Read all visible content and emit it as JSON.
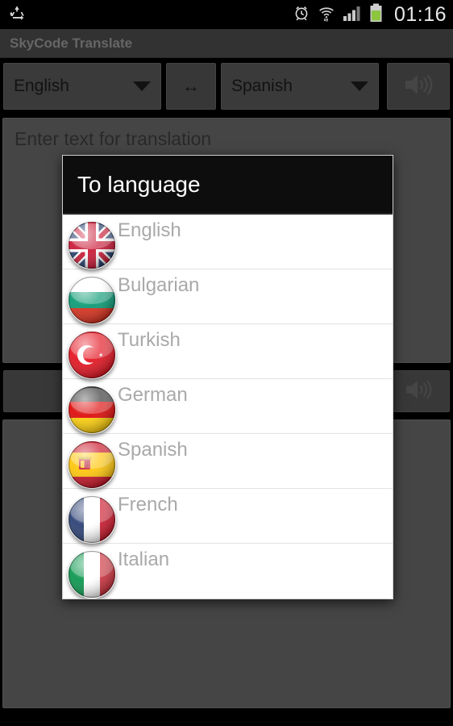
{
  "statusbar": {
    "left_icons": [
      {
        "name": "recycle-icon",
        "label": "recycle"
      }
    ],
    "right_icons": [
      {
        "name": "alarm-clock-icon",
        "label": "alarm"
      },
      {
        "name": "wifi-icon",
        "label": "wifi"
      },
      {
        "name": "signal-bars-icon",
        "label": "signal"
      },
      {
        "name": "battery-icon",
        "label": "battery"
      }
    ],
    "clock": "01:16"
  },
  "titlebar": {
    "app_title": "SkyCode Translate"
  },
  "toolbar": {
    "from_language": "English",
    "to_language": "Spanish",
    "swap_glyph": "↔",
    "swap_label": "Swap languages",
    "speak_label": "Speak"
  },
  "input": {
    "placeholder": "Enter text for translation"
  },
  "buttonbar": {
    "translate_label": "",
    "speak_label": ""
  },
  "output": {
    "text": ""
  },
  "dialog": {
    "title": "To language",
    "items": [
      {
        "label": "English",
        "flag": "flag-uk-icon"
      },
      {
        "label": "Bulgarian",
        "flag": "flag-bulgaria-icon"
      },
      {
        "label": "Turkish",
        "flag": "flag-turkey-icon"
      },
      {
        "label": "German",
        "flag": "flag-germany-icon"
      },
      {
        "label": "Spanish",
        "flag": "flag-spain-icon"
      },
      {
        "label": "French",
        "flag": "flag-france-icon"
      },
      {
        "label": "Italian",
        "flag": "flag-italy-icon"
      }
    ]
  },
  "colors": {
    "status_bg": "#000000",
    "title_bg": "#4d4d4d",
    "title_text": "#9d9d9d",
    "spinner_bg": "#5a5a5a",
    "pane_bg": "#6b6b6b",
    "dialog_head_bg": "#0d0d0d",
    "dialog_bg": "#ffffff",
    "list_text": "#a9a9a9",
    "battery_green": "#8cc63f"
  }
}
